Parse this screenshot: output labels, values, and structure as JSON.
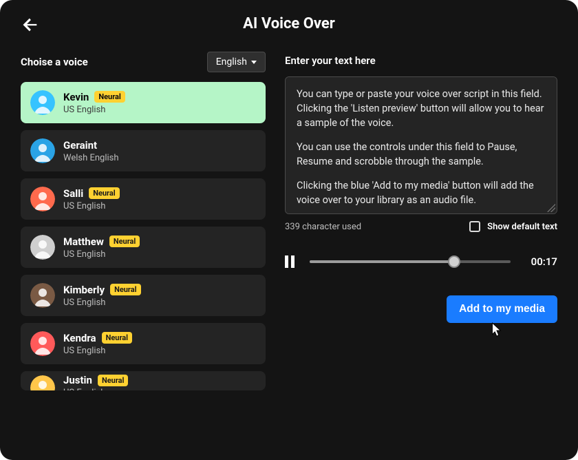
{
  "header": {
    "title": "AI Voice Over"
  },
  "left": {
    "label": "Choise a voice",
    "language_selected": "English"
  },
  "voices": [
    {
      "name": "Kevin",
      "neural": true,
      "sub": "US English",
      "avatar_bg": "#36c3ff",
      "selected": true
    },
    {
      "name": "Geraint",
      "neural": false,
      "sub": "Welsh English",
      "avatar_bg": "#2aa3e6",
      "selected": false
    },
    {
      "name": "Salli",
      "neural": true,
      "sub": "US English",
      "avatar_bg": "#ff6a4d",
      "selected": false
    },
    {
      "name": "Matthew",
      "neural": true,
      "sub": "US English",
      "avatar_bg": "#cfcfcf",
      "selected": false
    },
    {
      "name": "Kimberly",
      "neural": true,
      "sub": "US English",
      "avatar_bg": "#7a5a44",
      "selected": false
    },
    {
      "name": "Kendra",
      "neural": true,
      "sub": "US English",
      "avatar_bg": "#ff5a5a",
      "selected": false
    },
    {
      "name": "Justin",
      "neural": true,
      "sub": "US English",
      "avatar_bg": "#ffc64a",
      "selected": false
    }
  ],
  "badge_label": "Neural",
  "right": {
    "enter_label": "Enter your text here",
    "script_p1": "You can type or paste your voice over script in this field. Clicking the 'Listen preview' button will allow you to hear a sample of the voice.",
    "script_p2": "You can use the  controls under this field to Pause, Resume and scrobble through the sample.",
    "script_p3": "Clicking the blue 'Add to my media' button will add the voice over to your library as an audio file.",
    "char_used": "339 character used",
    "show_default_label": "Show default text",
    "time": "00:17",
    "cta_label": "Add to my media"
  }
}
